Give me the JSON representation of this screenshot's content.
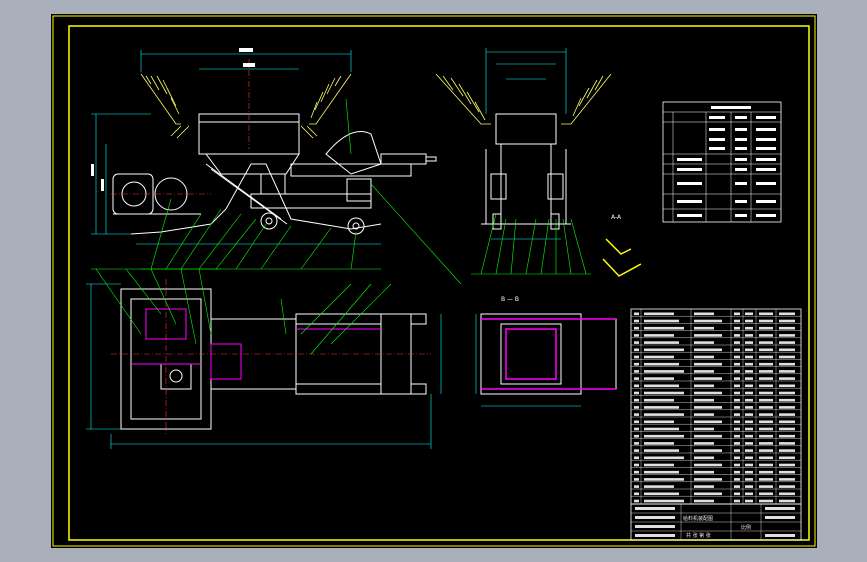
{
  "drawing": {
    "section_label_aa": "A-A",
    "section_label_bb": "B — B",
    "title_block": {
      "drawing_name": "给料机装配图",
      "rows": [
        "标记",
        "处数",
        "分区",
        "更改文件号",
        "签名",
        "年月日"
      ],
      "scale_label": "比例",
      "sheet_label": "共  张  第  张"
    }
  },
  "colors": {
    "background": "#a9b0bb",
    "paper": "#000000",
    "frame": "#ffff00",
    "geometry": "#ffffff",
    "dimension": "#00ffff",
    "leader": "#00ff00",
    "hatch": "#ffff66",
    "hidden": "#ff00ff",
    "center": "#ff3030"
  }
}
